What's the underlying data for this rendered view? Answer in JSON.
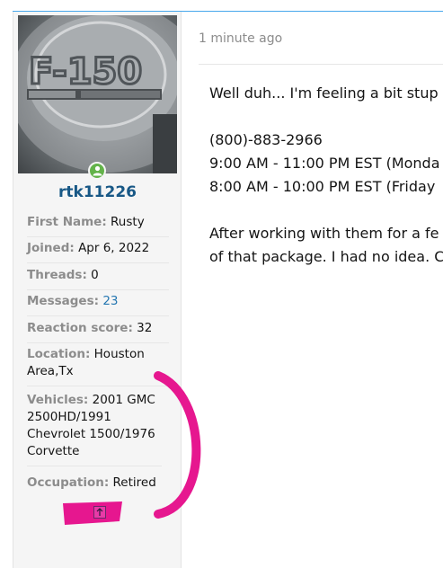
{
  "post": {
    "timestamp": "1 minute ago",
    "lines": [
      "Well duh... I'm feeling a bit stup",
      "",
      "(800)-883-2966",
      "9:00 AM - 11:00 PM EST (Monda",
      "8:00 AM - 10:00 PM EST (Friday",
      "",
      "After working with them for a fe",
      "of that package. I had no idea. C"
    ]
  },
  "user": {
    "username": "rtk11226",
    "avatar_text": "F-150",
    "fields": [
      {
        "key": "First Name:",
        "value": "Rusty"
      },
      {
        "key": "Joined:",
        "value": "Apr 6, 2022"
      },
      {
        "key": "Threads:",
        "value": "0"
      },
      {
        "key": "Messages:",
        "value": "23"
      },
      {
        "key": "Reaction score:",
        "value": "32"
      },
      {
        "key": "Location:",
        "value": "Houston Area,Tx"
      },
      {
        "key": "Vehicles:",
        "value": "2001 GMC 2500HD/1991 Chevrolet 1500/1976 Corvette"
      },
      {
        "key": "Occupation:",
        "value": "Retired"
      }
    ]
  },
  "colors": {
    "accent": "#185886",
    "link": "#2577b1",
    "online": "#63b34a",
    "annotation": "#e6178f"
  },
  "icons": {
    "online": "user-online-icon",
    "scroll": "arrow-up-icon"
  }
}
